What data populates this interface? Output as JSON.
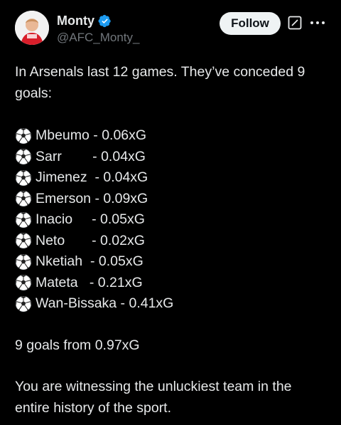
{
  "author": {
    "display_name": "Monty",
    "handle": "@AFC_Monty_",
    "verified": true,
    "avatar_icon": "person-in-red-kit-avatar",
    "accent_color": "#1d9bf0"
  },
  "header": {
    "follow_label": "Follow",
    "grok_icon": "grok-icon",
    "more_icon": "more-dots-icon"
  },
  "tweet": {
    "intro": "In Arsenals last 12 games. They’ve conceded 9 goals:",
    "list_icon": "soccer-ball-icon",
    "items": [
      "Mbeumo - 0.06xG",
      "Sarr        - 0.04xG",
      "Jimenez  - 0.04xG",
      "Emerson - 0.09xG",
      "Inacio     - 0.05xG",
      "Neto       - 0.02xG",
      "Nketiah  - 0.05xG",
      "Mateta   - 0.21xG",
      "Wan-Bissaka - 0.41xG"
    ],
    "summary": "9 goals from 0.97xG",
    "closing": "You are witnessing the unluckiest team in the entire history of the sport."
  }
}
